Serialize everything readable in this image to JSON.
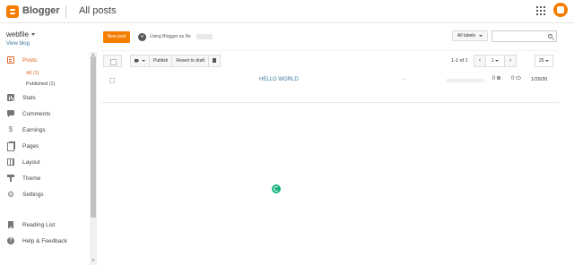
{
  "header": {
    "brand": "Blogger",
    "page_title": "All posts",
    "apps_icon": "apps-grid-icon",
    "avatar_icon": "blogger-avatar-icon"
  },
  "sidebar": {
    "blog_name": "webfile",
    "view_blog": "View blog",
    "items": [
      {
        "label": "Posts",
        "icon": "posts-icon",
        "active": true
      },
      {
        "label": "Stats",
        "icon": "stats-icon"
      },
      {
        "label": "Comments",
        "icon": "comments-icon"
      },
      {
        "label": "Earnings",
        "icon": "dollar-icon"
      },
      {
        "label": "Pages",
        "icon": "pages-icon"
      },
      {
        "label": "Layout",
        "icon": "layout-icon"
      },
      {
        "label": "Theme",
        "icon": "theme-icon"
      },
      {
        "label": "Settings",
        "icon": "gear-icon"
      },
      {
        "label": "Reading List",
        "icon": "bookmark-icon"
      },
      {
        "label": "Help & Feedback",
        "icon": "help-icon"
      }
    ],
    "sub_items": [
      {
        "label": "All (1)",
        "active": true
      },
      {
        "label": "Published (1)"
      }
    ]
  },
  "toolbar": {
    "new_post": "New post",
    "using_text": "Using Blogger as Ne",
    "labels_filter": "All labels",
    "search_placeholder": "",
    "publish": "Publish",
    "revert": "Revert to draft",
    "page_count": "1-1 of 1",
    "prev": "‹",
    "page": "1",
    "next": "›",
    "page_size": "25"
  },
  "posts": [
    {
      "title": "HELLO WORLD",
      "ellipsis": "...",
      "comments": "0",
      "views": "0",
      "date": "1/29/20"
    }
  ],
  "colors": {
    "accent": "#f57d00",
    "active_text": "#e0621e",
    "link": "#3b78a0",
    "loader": "#14b37d"
  }
}
